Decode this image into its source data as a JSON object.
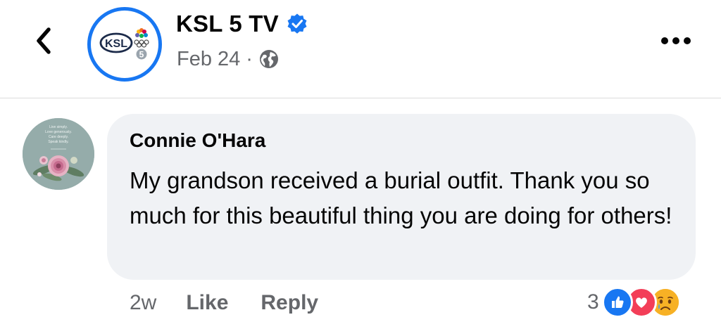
{
  "header": {
    "page_name": "KSL 5 TV",
    "logo_text": "KSL",
    "date": "Feb 24",
    "separator": "·",
    "verified_icon": "verified-badge-icon",
    "privacy_icon": "globe-icon",
    "more_icon": "more-options-icon",
    "back_icon": "back-chevron-icon"
  },
  "comment": {
    "author": "Connie O'Hara",
    "text": "My grandson received a burial outfit. Thank you so much for this beautiful thing you are doing for others!",
    "avatar_text": [
      "Live simply.",
      "Love generously.",
      "Care deeply.",
      "Speak kindly."
    ],
    "time": "2w",
    "like_label": "Like",
    "reply_label": "Reply",
    "reaction_count": "3",
    "reactions": [
      "like",
      "love",
      "sad"
    ]
  },
  "colors": {
    "accent": "#1877f2",
    "love": "#f33e58",
    "sad": "#f7b125",
    "bubble_bg": "#f0f2f5",
    "secondary_text": "#65676b"
  }
}
